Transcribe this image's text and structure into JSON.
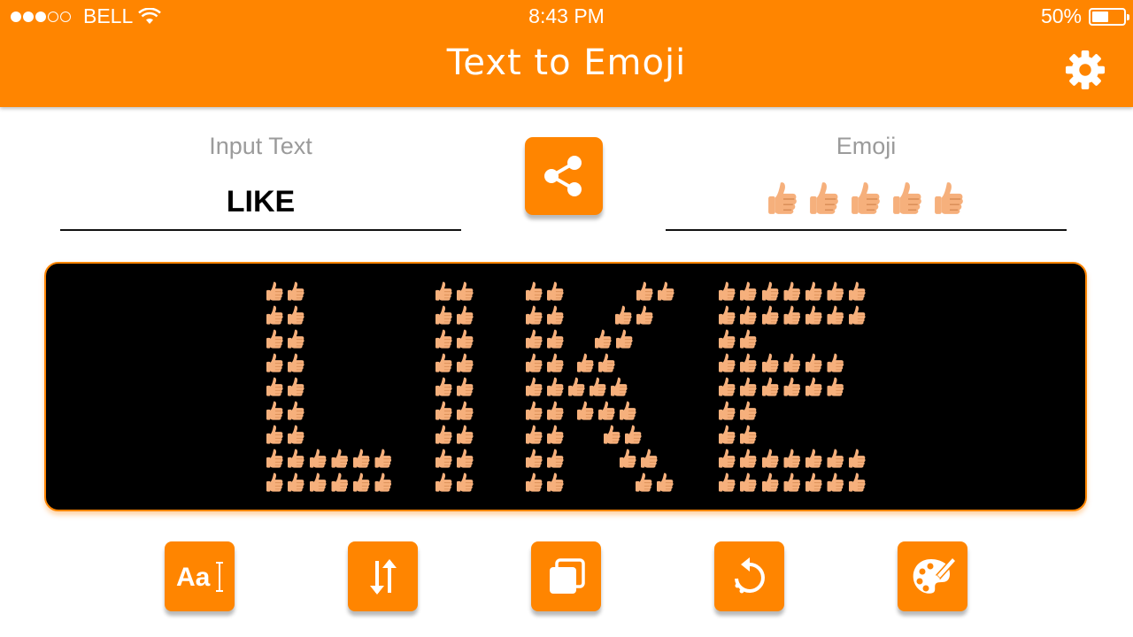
{
  "status_bar": {
    "carrier": "BELL",
    "signal_bars_filled": 3,
    "signal_bars_total": 5,
    "time": "8:43 PM",
    "battery_text": "50%",
    "battery_level": 0.5
  },
  "header": {
    "title": "Text to Emoji",
    "settings_icon": "gear-icon"
  },
  "input": {
    "label": "Input Text",
    "value": "LIKE"
  },
  "output": {
    "label": "Emoji",
    "emoji": "👍🏼👍🏼👍🏼👍🏼👍🏼",
    "emoji_count": 5
  },
  "share_icon": "share-icon",
  "display": {
    "text": "LIKE",
    "emoji": "👍🏼",
    "background": "#000000"
  },
  "toolbar": {
    "items": [
      {
        "name": "font-button",
        "icon": "font-icon"
      },
      {
        "name": "flip-button",
        "icon": "swap-vertical-icon"
      },
      {
        "name": "copy-button",
        "icon": "copy-icon"
      },
      {
        "name": "rotate-button",
        "icon": "rotate-icon"
      },
      {
        "name": "color-button",
        "icon": "palette-icon"
      }
    ]
  },
  "colors": {
    "accent": "#ff8500",
    "label_gray": "#9b9b9b",
    "emoji_skin": "#f6b07c"
  }
}
